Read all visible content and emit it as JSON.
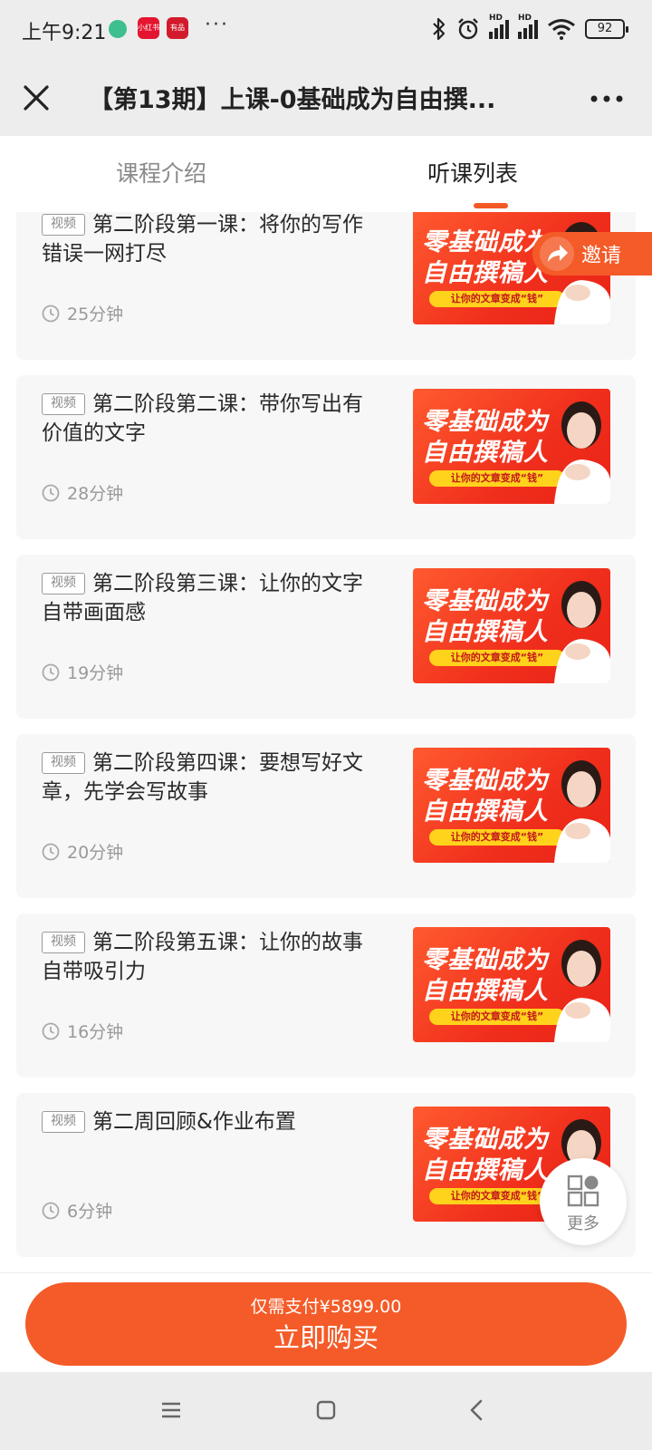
{
  "status_bar": {
    "time": "上午9:21",
    "app_badges": [
      "小红书",
      "有品"
    ],
    "more": "···",
    "battery": "92",
    "signal_label": "HD"
  },
  "header": {
    "title": "【第13期】上课-0基础成为自由撰...",
    "close_icon": "close-icon",
    "menu_icon": "more-dots-icon"
  },
  "tabs": [
    {
      "label": "课程介绍",
      "active": false
    },
    {
      "label": "听课列表",
      "active": true
    }
  ],
  "lessons": [
    {
      "badge": "视频",
      "title": "第二阶段第一课：将你的写作错误一网打尽",
      "duration": "25分钟"
    },
    {
      "badge": "视频",
      "title": "第二阶段第二课：带你写出有价值的文字",
      "duration": "28分钟"
    },
    {
      "badge": "视频",
      "title": "第二阶段第三课：让你的文字自带画面感",
      "duration": "19分钟"
    },
    {
      "badge": "视频",
      "title": "第二阶段第四课：要想写好文章，先学会写故事",
      "duration": "20分钟"
    },
    {
      "badge": "视频",
      "title": "第二阶段第五课：让你的故事自带吸引力",
      "duration": "16分钟"
    },
    {
      "badge": "视频",
      "title": "第二周回顾&作业布置",
      "duration": "6分钟"
    }
  ],
  "thumbnail": {
    "line1": "零基础成为",
    "line2": "自由撰稿人",
    "strip": "让你的文章变成“钱”"
  },
  "invite": {
    "label": "邀请",
    "icon": "share-arrow-icon"
  },
  "more_fab": {
    "label": "更多",
    "icon": "grid-icon"
  },
  "buy": {
    "price_text": "仅需支付¥5899.00",
    "label": "立即购买"
  },
  "colors": {
    "accent": "#f45b28",
    "thumb_red": "#f02e1c",
    "strip_yellow": "#ffd21c"
  }
}
